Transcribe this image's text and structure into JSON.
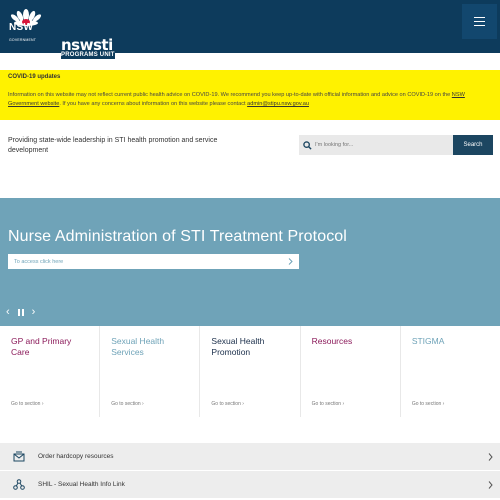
{
  "header": {
    "logo_text": "NSW",
    "logo_sub": "GOVERNMENT",
    "brand_name": "nswsti",
    "brand_sub": "PROGRAMS UNIT",
    "menu_icon": "hamburger-icon"
  },
  "covid": {
    "title": "COVID-19 updates",
    "text_1": "Information on this website may not reflect current public health advice on COVID-19. We recommend you keep up-to-date with official information and advice on COVID-19 on the ",
    "link_1": "NSW Government website",
    "text_2": ". If you have any concerns about information on this website please contact ",
    "link_2": "admin@stipu.nsw.gov.au"
  },
  "tagline": "Providing state-wide leadership in STI health promotion and service development",
  "search": {
    "placeholder": "I'm looking for...",
    "button_label": "Search"
  },
  "hero": {
    "title": "Nurse Administration of STI Treatment Protocol",
    "link_label": "To access click here",
    "prev_label": "‹",
    "next_label": "›"
  },
  "cards": [
    {
      "title": "GP and Primary Care",
      "goto": "Go to section",
      "color": "#8b1a5a"
    },
    {
      "title": "Sexual Health Services",
      "goto": "Go to section",
      "color": "#6fa3b8"
    },
    {
      "title": "Sexual Health Promotion",
      "goto": "Go to section",
      "color": "#1a2e4a"
    },
    {
      "title": "Resources",
      "goto": "Go to section",
      "color": "#8b1a5a"
    },
    {
      "title": "STIGMA",
      "goto": "Go to section",
      "color": "#6fa3b8"
    }
  ],
  "quick_links": [
    {
      "label": "Order hardcopy resources",
      "icon": "envelope-icon"
    },
    {
      "label": "SHIL - Sexual Health Info Link",
      "icon": "network-icon"
    }
  ],
  "colors": {
    "header_bg": "#0d3b5c",
    "banner_bg": "#fff200",
    "hero_bg": "#6fa3b8",
    "search_btn": "#1c4661"
  }
}
